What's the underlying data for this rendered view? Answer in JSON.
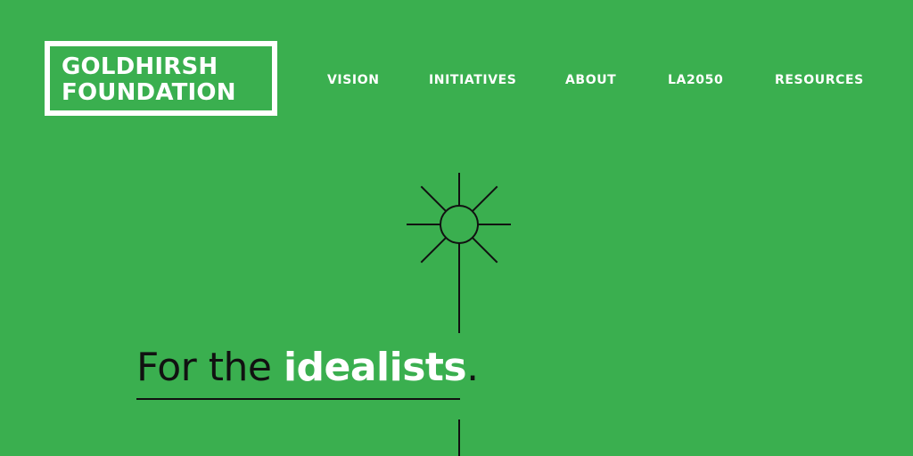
{
  "brand": {
    "line1": "GOLDHIRSH",
    "line2": "FOUNDATION",
    "color": "#ffffff"
  },
  "nav": {
    "items": [
      {
        "label": "VISION"
      },
      {
        "label": "INITIATIVES"
      },
      {
        "label": "ABOUT"
      },
      {
        "label": "LA2050"
      },
      {
        "label": "RESOURCES"
      }
    ]
  },
  "hero": {
    "icon": "sun-icon",
    "tagline_prefix": "For the ",
    "tagline_emphasis": "idealists",
    "tagline_suffix": "."
  },
  "colors": {
    "background": "#3aaf4f",
    "text_dark": "#111111",
    "text_light": "#ffffff"
  }
}
